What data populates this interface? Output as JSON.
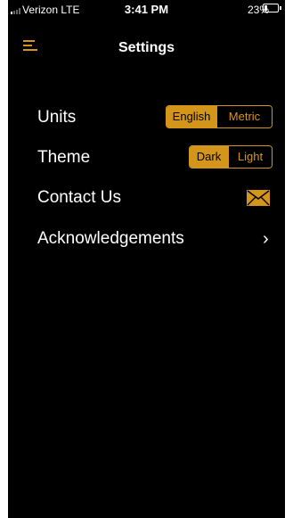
{
  "status_bar": {
    "carrier": "Verizon  LTE",
    "time": "3:41 PM",
    "battery_percent": "23%",
    "battery_level": 0.23
  },
  "nav": {
    "title": "Settings",
    "menu_icon": "hamburger-menu-icon"
  },
  "settings": {
    "units": {
      "label": "Units",
      "options": [
        "English",
        "Metric"
      ],
      "selected": "English"
    },
    "theme": {
      "label": "Theme",
      "options": [
        "Dark",
        "Light"
      ],
      "selected": "Dark"
    },
    "contact": {
      "label": "Contact Us",
      "icon": "envelope-icon"
    },
    "acknowledgements": {
      "label": "Acknowledgements",
      "icon": "chevron-right-icon",
      "chevron": "›"
    }
  },
  "colors": {
    "accent": "#d4961a",
    "background": "#000000",
    "text": "#ffffff"
  }
}
